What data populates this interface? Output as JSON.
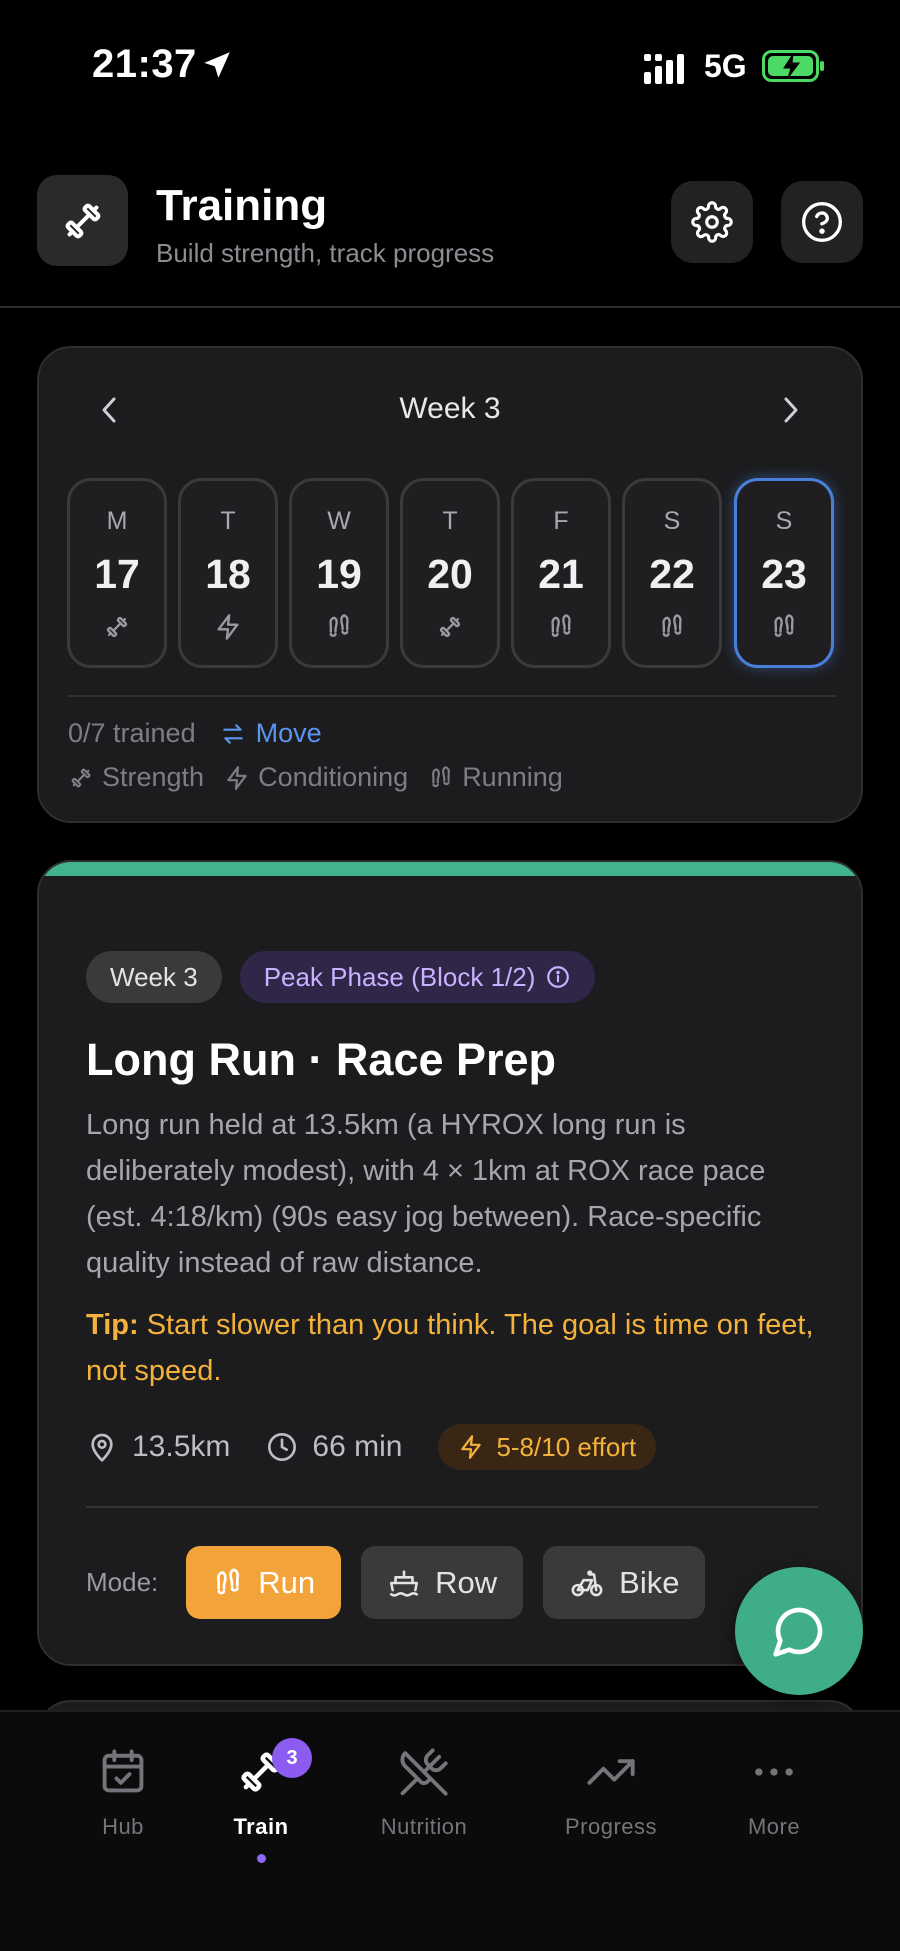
{
  "status_bar": {
    "time": "21:37",
    "network": "5G"
  },
  "header": {
    "title": "Training",
    "subtitle": "Build strength, track progress"
  },
  "week": {
    "label": "Week 3",
    "days": [
      {
        "letter": "M",
        "num": "17",
        "type": "strength"
      },
      {
        "letter": "T",
        "num": "18",
        "type": "conditioning"
      },
      {
        "letter": "W",
        "num": "19",
        "type": "running"
      },
      {
        "letter": "T",
        "num": "20",
        "type": "strength"
      },
      {
        "letter": "F",
        "num": "21",
        "type": "running"
      },
      {
        "letter": "S",
        "num": "22",
        "type": "running"
      },
      {
        "letter": "S",
        "num": "23",
        "type": "running",
        "selected": true
      }
    ],
    "trained": "0/7 trained",
    "move_label": "Move",
    "legend": {
      "strength": "Strength",
      "conditioning": "Conditioning",
      "running": "Running"
    }
  },
  "workout": {
    "week_chip": "Week 3",
    "phase_chip": "Peak Phase (Block 1/2)",
    "title": "Long Run · Race Prep",
    "description": "Long run held at 13.5km (a HYROX long run is deliberately modest), with 4 × 1km at ROX race pace (est. 4:18/km) (90s easy jog between). Race-specific quality instead of raw distance.",
    "tip_label": "Tip:",
    "tip_text": "Start slower than you think. The goal is time on feet, not speed.",
    "distance": "13.5km",
    "duration": "66 min",
    "effort": "5-8/10 effort",
    "mode_label": "Mode:",
    "modes": {
      "run": "Run",
      "row": "Row",
      "bike": "Bike"
    },
    "accent_color": "#41b38d"
  },
  "tabs": {
    "hub": "Hub",
    "train": "Train",
    "train_badge": "3",
    "nutrition": "Nutrition",
    "progress": "Progress",
    "more": "More"
  }
}
